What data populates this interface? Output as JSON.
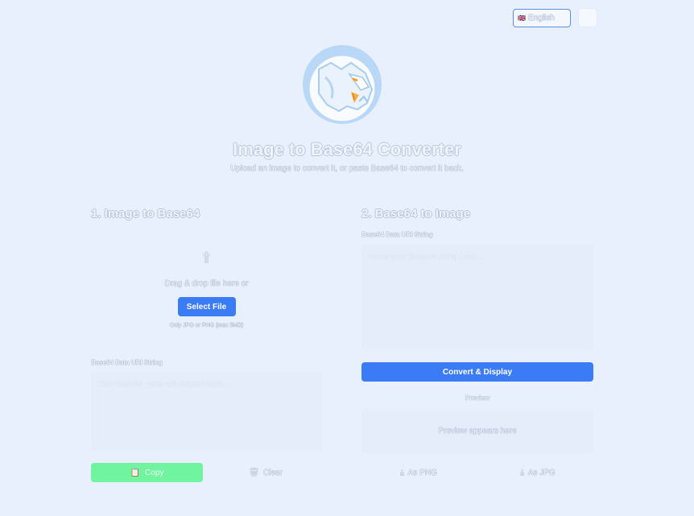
{
  "header": {
    "language": {
      "flag": "🇬🇧",
      "selected": "English"
    }
  },
  "hero": {
    "title": "Image to Base64 Converter",
    "subtitle": "Upload an image to convert it, or paste Base64 to convert it back."
  },
  "left": {
    "heading": "1. Image to Base64",
    "drop_text": "Drag & drop file here or",
    "select_button": "Select File",
    "only_text": "Only JPG or PNG (max 5MB)",
    "output_label": "Base64 Data URI String",
    "output_placeholder": "Your Base64 code will appear here...",
    "copy_button": "Copy",
    "clear_button": "Clear"
  },
  "right": {
    "heading": "2. Base64 to Image",
    "input_label": "Base64 Data URI String",
    "input_placeholder": "Paste your Base64 string here...",
    "convert_button": "Convert & Display",
    "preview_label": "Preview",
    "preview_placeholder": "Preview appears here",
    "png_button": "As PNG",
    "jpg_button": "As JPG"
  },
  "colors": {
    "background": "#e8f0fd",
    "primary": "#3b7bf6",
    "success": "#71f4a0"
  }
}
